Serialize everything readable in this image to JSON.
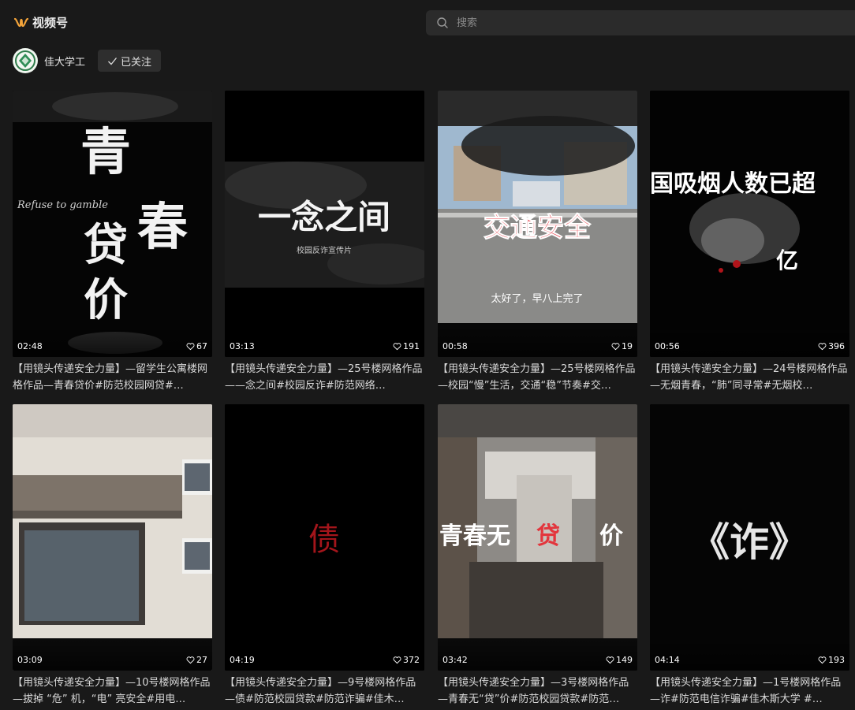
{
  "header": {
    "brand_text": "视频号",
    "search_placeholder": "搜索"
  },
  "account": {
    "name": "佳大学工",
    "follow_label": "已关注"
  },
  "accent": "#f2a33a",
  "videos": [
    {
      "duration": "02:48",
      "likes": "67",
      "cover_text": [
        "青",
        "春",
        "贷",
        "价"
      ],
      "cover_subtext": "Refuse to gamble",
      "title": "【用镜头传递安全力量】—留学生公寓楼网格作品—青春贷价#防范校园网贷#…"
    },
    {
      "duration": "03:13",
      "likes": "191",
      "cover_text": [
        "一念之间"
      ],
      "cover_subtext": "校园反诈宣传片",
      "title": "【用镜头传递安全力量】—25号楼网格作品——念之间#校园反诈#防范网络…"
    },
    {
      "duration": "00:58",
      "likes": "19",
      "cover_text": [
        "交通安全"
      ],
      "cover_subtext": "太好了，早八上完了",
      "title": "【用镜头传递安全力量】—25号楼网格作品—校园“慢”生活，交通“稳”节奏#交…"
    },
    {
      "duration": "00:56",
      "likes": "396",
      "cover_text": [
        "国吸烟人数已超"
      ],
      "cover_subtext": "亿",
      "title": "【用镜头传递安全力量】—24号楼网格作品—无烟青春，“肺”同寻常#无烟校…"
    },
    {
      "duration": "03:09",
      "likes": "27",
      "cover_text": [],
      "cover_subtext": "",
      "title": "【用镜头传递安全力量】—10号楼网格作品—拔掉 “危” 机，“电” 亮安全#用电…"
    },
    {
      "duration": "04:19",
      "likes": "372",
      "cover_text": [
        "债"
      ],
      "cover_subtext": "",
      "title": "【用镜头传递安全力量】—9号楼网格作品—债#防范校园贷款#防范诈骗#佳木…"
    },
    {
      "duration": "03:42",
      "likes": "149",
      "cover_text": [
        "青春无",
        "贷",
        "价"
      ],
      "cover_subtext": "",
      "title": "【用镜头传递安全力量】—3号楼网格作品—青春无“贷”价#防范校园贷款#防范…"
    },
    {
      "duration": "04:14",
      "likes": "193",
      "cover_text": [
        "《诈》"
      ],
      "cover_subtext": "",
      "title": "【用镜头传递安全力量】—1号楼网格作品—诈#防范电信诈骗#佳木斯大学 #…"
    }
  ]
}
